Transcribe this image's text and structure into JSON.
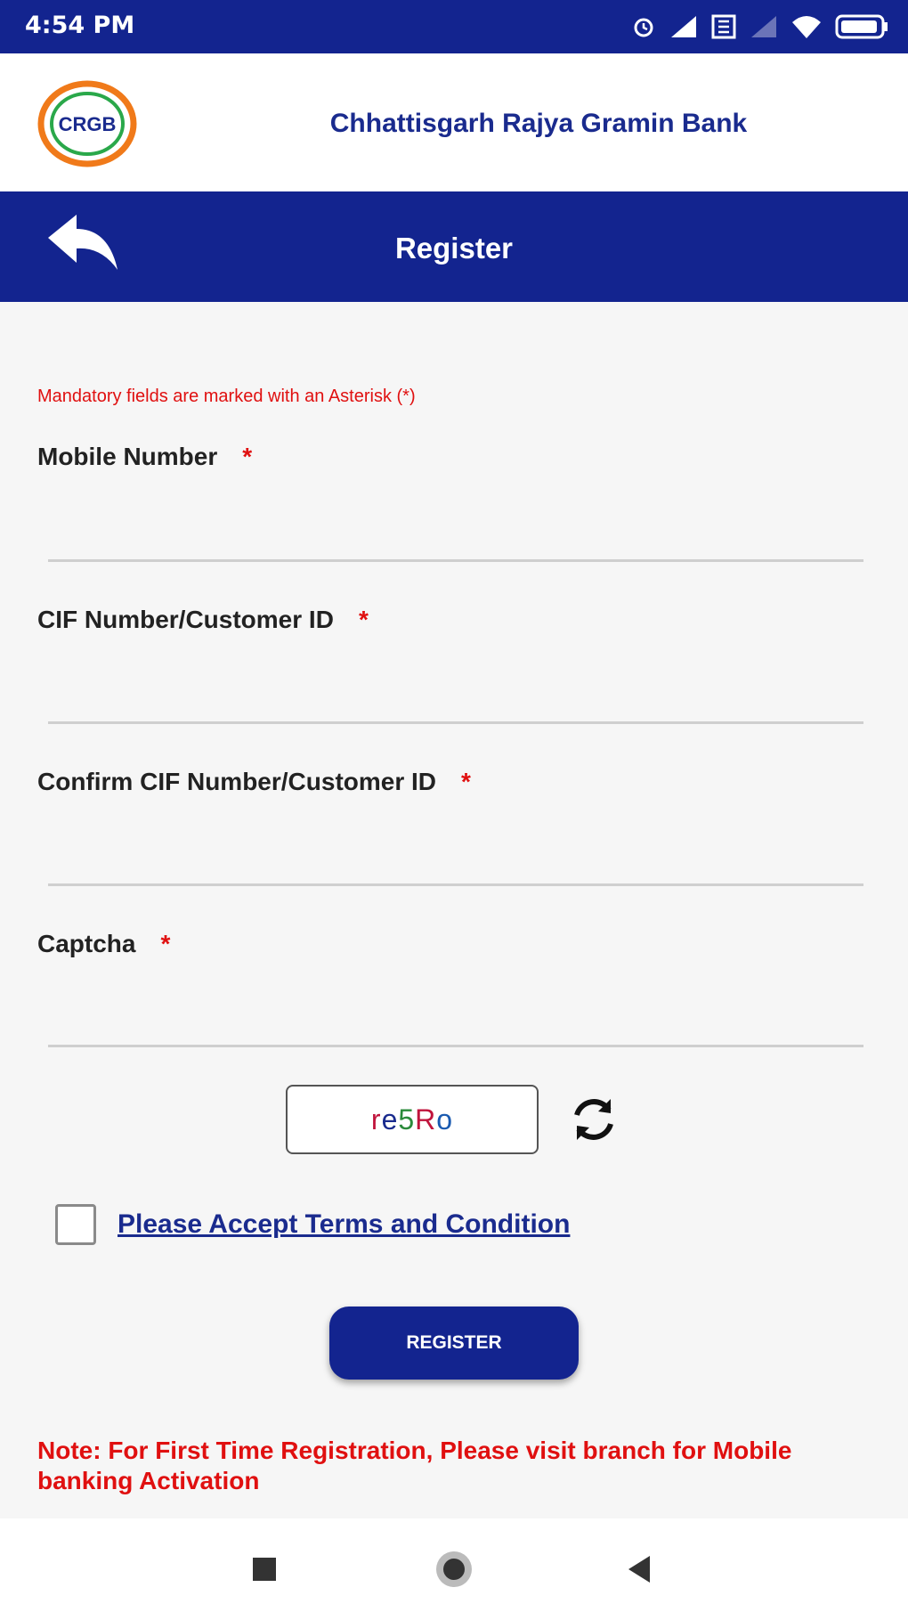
{
  "status_bar": {
    "time": "4:54 PM",
    "icons": [
      "alarm-icon",
      "signal-icon",
      "data-icon",
      "signal-weak-icon",
      "wifi-icon",
      "battery-icon"
    ]
  },
  "header": {
    "logo_text": "CRGB",
    "bank_name": "Chhattisgarh Rajya Gramin Bank"
  },
  "nav": {
    "title": "Register",
    "back_icon": "back-arrow-icon"
  },
  "form": {
    "mandatory_note": "Mandatory fields are marked with an Asterisk (*)",
    "fields": [
      {
        "label": "Mobile Number",
        "required": "*",
        "value": ""
      },
      {
        "label": "CIF Number/Customer ID",
        "required": "*",
        "value": ""
      },
      {
        "label": "Confirm CIF Number/Customer ID",
        "required": "*",
        "value": ""
      },
      {
        "label": "Captcha",
        "required": "*",
        "value": ""
      }
    ],
    "captcha_text": "re5Ro",
    "refresh_icon": "refresh-icon",
    "terms_checked": false,
    "terms_label": "Please Accept Terms and Condition",
    "register_label": "REGISTER",
    "note": "Note: For First Time Registration, Please visit branch for Mobile banking Activation"
  },
  "system_nav": [
    "recents-icon",
    "home-icon",
    "back-icon"
  ],
  "colors": {
    "primary": "#13248f",
    "accent_red": "#e01010",
    "logo_orange": "#f07a1a",
    "logo_green": "#2aa84a"
  }
}
